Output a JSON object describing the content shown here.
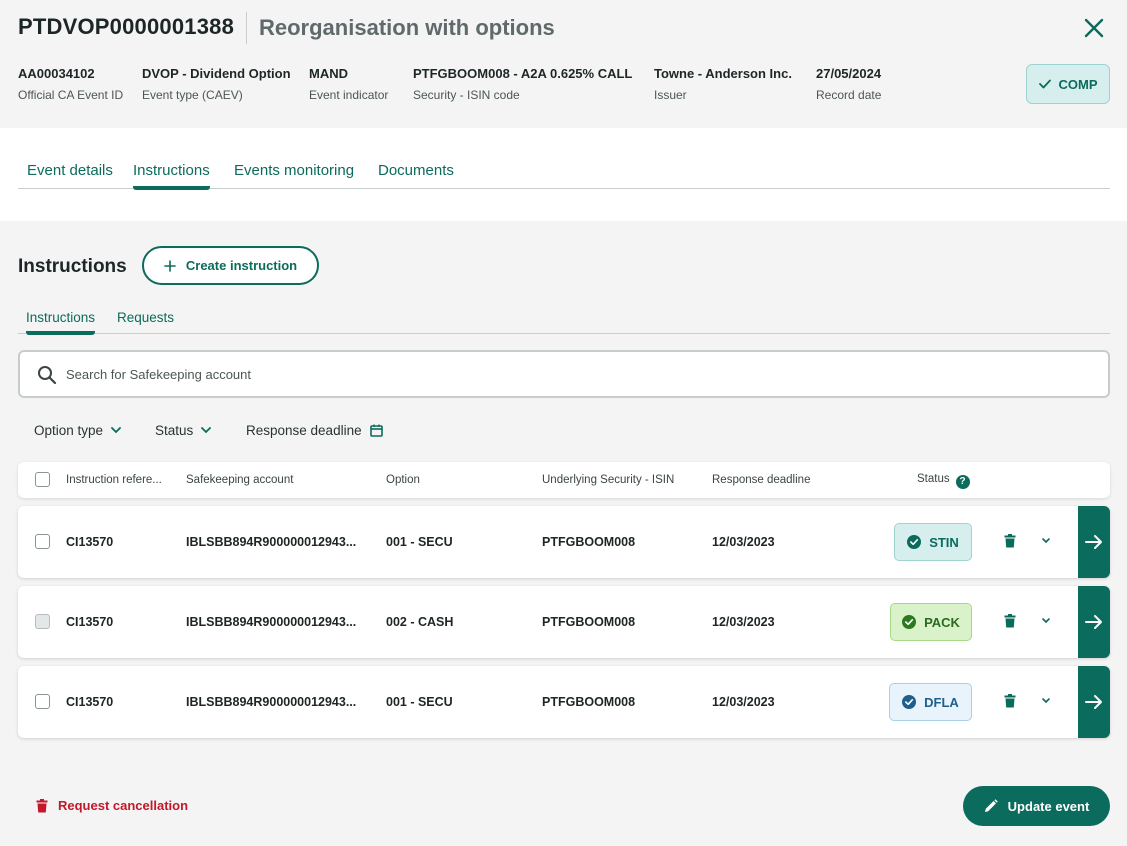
{
  "header": {
    "event_id": "PTDVOP0000001388",
    "event_title": "Reorganisation with options",
    "status_badge": "COMP",
    "meta": [
      {
        "value": "AA00034102",
        "label": "Official CA Event ID"
      },
      {
        "value": "DVOP - Dividend Option",
        "label": "Event type (CAEV)"
      },
      {
        "value": "MAND",
        "label": "Event indicator"
      },
      {
        "value": "PTFGBOOM008 - A2A 0.625% CALL",
        "label": "Security - ISIN code"
      },
      {
        "value": "Towne - Anderson Inc.",
        "label": "Issuer"
      },
      {
        "value": "27/05/2024",
        "label": "Record date"
      }
    ]
  },
  "main_tabs": [
    "Event details",
    "Instructions",
    "Events monitoring",
    "Documents"
  ],
  "section": {
    "title": "Instructions",
    "create_label": "Create instruction"
  },
  "sub_tabs": [
    "Instructions",
    "Requests"
  ],
  "search": {
    "placeholder": "Search for Safekeeping account"
  },
  "filters": [
    "Option type",
    "Status",
    "Response deadline"
  ],
  "table": {
    "columns": [
      "Instruction refere...",
      "Safekeeping account",
      "Option",
      "Underlying Security - ISIN",
      "Response deadline",
      "Status"
    ],
    "rows": [
      {
        "ref": "CI13570",
        "account": "IBLSBB894R900000012943...",
        "option": "001 - SECU",
        "isin": "PTFGBOOM008",
        "deadline": "12/03/2023",
        "status": "STIN"
      },
      {
        "ref": "CI13570",
        "account": "IBLSBB894R900000012943...",
        "option": "002 - CASH",
        "isin": "PTFGBOOM008",
        "deadline": "12/03/2023",
        "status": "PACK"
      },
      {
        "ref": "CI13570",
        "account": "IBLSBB894R900000012943...",
        "option": "001 - SECU",
        "isin": "PTFGBOOM008",
        "deadline": "12/03/2023",
        "status": "DFLA"
      }
    ]
  },
  "footer": {
    "cancel_label": "Request cancellation",
    "update_label": "Update event"
  },
  "colors": {
    "accent": "#0b6b5c",
    "danger": "#c2182b",
    "status_stin": "#d6efee",
    "status_pack": "#d9f2c9",
    "status_dfla": "#e8f3fb"
  }
}
